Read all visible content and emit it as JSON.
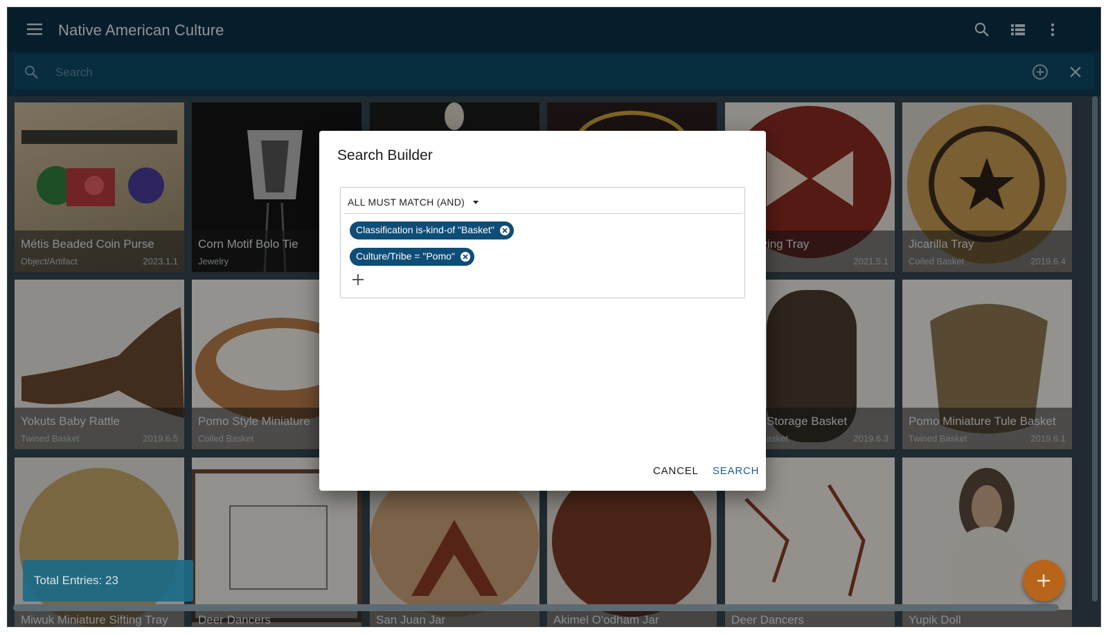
{
  "app": {
    "title": "Native American Culture"
  },
  "search": {
    "placeholder": "Search"
  },
  "cards": [
    {
      "name": "Métis Beaded Coin Purse",
      "type": "Object/Artifact",
      "number": "2023.1.1"
    },
    {
      "name": "Corn Motif Bolo Tie",
      "type": "Jewelry",
      "number": ""
    },
    {
      "name": "",
      "type": "",
      "number": ""
    },
    {
      "name": "",
      "type": "",
      "number": ""
    },
    {
      "name": "w Serving Tray",
      "type": "",
      "number": "2021.5.1"
    },
    {
      "name": "Jicarilla Tray",
      "type": "Coiled Basket",
      "number": "2019.6.4"
    },
    {
      "name": "Yokuts Baby Rattle",
      "type": "Twined Basket",
      "number": "2019.6.5"
    },
    {
      "name": "Pomo Style Miniature",
      "type": "Coiled Basket",
      "number": ""
    },
    {
      "name": "",
      "type": "",
      "number": ""
    },
    {
      "name": "",
      "type": "",
      "number": ""
    },
    {
      "name": "Storage Basket",
      "type": "asket",
      "number": "2019.6.3"
    },
    {
      "name": "Pomo Miniature Tule Basket",
      "type": "Twined Basket",
      "number": "2019.6.1"
    },
    {
      "name": "Miwuk Miniature Sifting Tray",
      "type": "",
      "number": ""
    },
    {
      "name": "Deer Dancers",
      "type": "",
      "number": ""
    },
    {
      "name": "San Juan Jar",
      "type": "",
      "number": ""
    },
    {
      "name": "Akimel O'odham Jar",
      "type": "",
      "number": ""
    },
    {
      "name": "Deer Dancers",
      "type": "",
      "number": ""
    },
    {
      "name": "Yupik Doll",
      "type": "",
      "number": ""
    }
  ],
  "total_label": "Total Entries: 23",
  "dialog": {
    "title": "Search Builder",
    "match_mode": "ALL MUST MATCH (AND)",
    "conditions": [
      {
        "label": "Classification is-kind-of \"Basket\""
      },
      {
        "label": "Culture/Tribe = \"Pomo\""
      }
    ],
    "cancel_label": "CANCEL",
    "search_label": "SEARCH"
  },
  "colors": {
    "appbar": "#0a2f47",
    "chip": "#0e4d77",
    "fab": "#b8641a",
    "primary_text_button": "#1a5c94"
  },
  "icons": [
    "menu-icon",
    "search-icon",
    "list-view-icon",
    "more-vert-icon",
    "add-circle-icon",
    "close-icon",
    "add-icon",
    "cancel-chip-icon"
  ]
}
